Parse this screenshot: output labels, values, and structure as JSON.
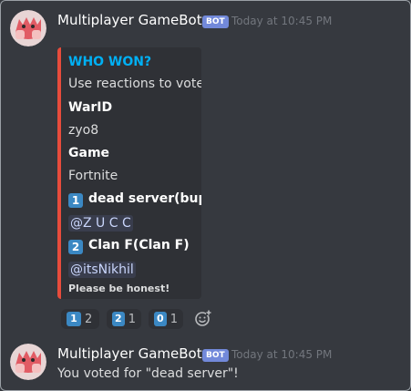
{
  "messages": [
    {
      "author": "Multiplayer GameBot",
      "bot_tag": "BOT",
      "timestamp": "Today at 10:45 PM",
      "embed": {
        "title": "WHO WON?",
        "description": "Use reactions to vote!",
        "fields": [
          {
            "name": "WarID",
            "value": "zyo8"
          },
          {
            "name": "Game",
            "value": "Fortnite"
          },
          {
            "badge": "1",
            "name": "dead server(bupg)",
            "value": "@Z U C C"
          },
          {
            "badge": "2",
            "name": "Clan F(Clan F)",
            "value": "@itsNikhil"
          }
        ],
        "footer": "Please be honest!",
        "accent_color": "#e74c3c"
      },
      "reactions": [
        {
          "emoji": "1",
          "count": "2"
        },
        {
          "emoji": "2",
          "count": "1"
        },
        {
          "emoji": "0",
          "count": "1"
        }
      ]
    },
    {
      "author": "Multiplayer GameBot",
      "bot_tag": "BOT",
      "timestamp": "Today at 10:45 PM",
      "content": "You voted for \"dead server\"!"
    }
  ],
  "colors": {
    "background": "#36393f",
    "embed_bg": "#2f3136",
    "link": "#00b0f4",
    "bot_tag": "#7289da",
    "keycap": "#3b88c3"
  },
  "icons": {
    "avatar": "red-monster-avatar-icon",
    "add_reaction": "add-reaction-icon"
  }
}
